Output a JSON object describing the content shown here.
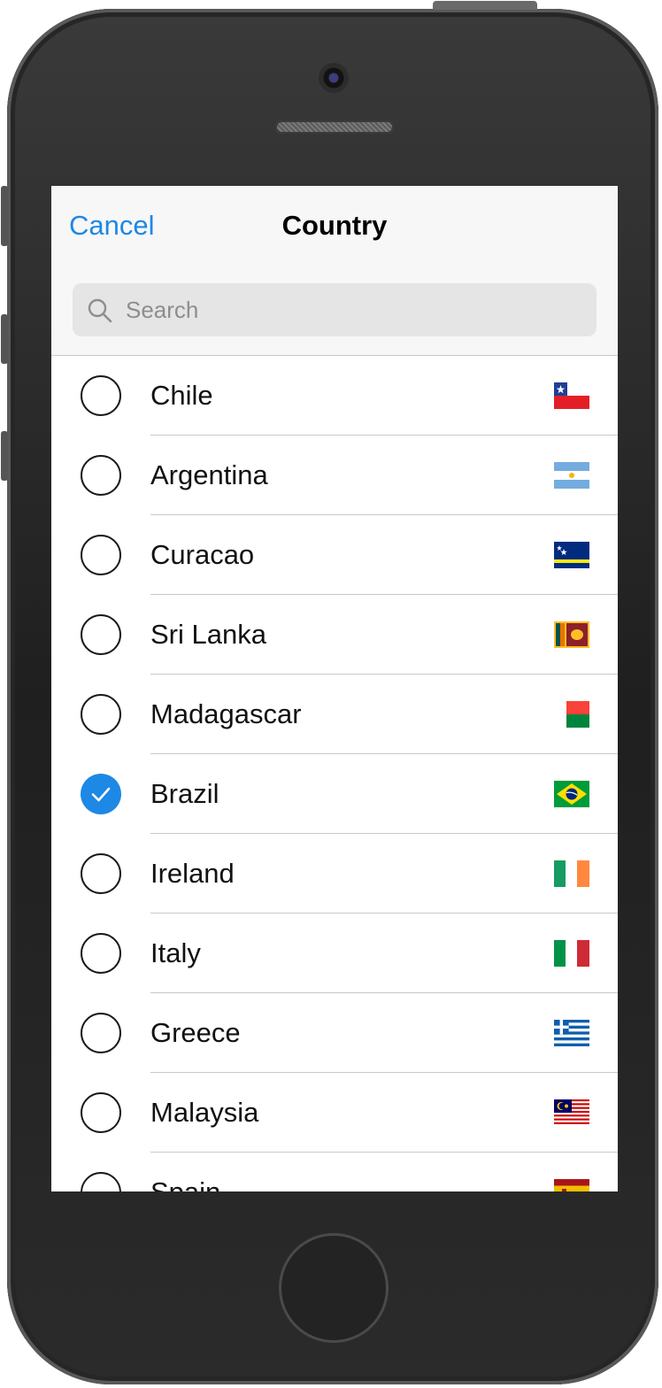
{
  "header": {
    "cancel_label": "Cancel",
    "title": "Country"
  },
  "search": {
    "placeholder": "Search"
  },
  "countries": [
    {
      "name": "Chile",
      "selected": false,
      "flag_icon": "chile-flag-icon"
    },
    {
      "name": "Argentina",
      "selected": false,
      "flag_icon": "argentina-flag-icon"
    },
    {
      "name": "Curacao",
      "selected": false,
      "flag_icon": "curacao-flag-icon"
    },
    {
      "name": "Sri Lanka",
      "selected": false,
      "flag_icon": "sri-lanka-flag-icon"
    },
    {
      "name": "Madagascar",
      "selected": false,
      "flag_icon": "madagascar-flag-icon"
    },
    {
      "name": "Brazil",
      "selected": true,
      "flag_icon": "brazil-flag-icon"
    },
    {
      "name": "Ireland",
      "selected": false,
      "flag_icon": "ireland-flag-icon"
    },
    {
      "name": "Italy",
      "selected": false,
      "flag_icon": "italy-flag-icon"
    },
    {
      "name": "Greece",
      "selected": false,
      "flag_icon": "greece-flag-icon"
    },
    {
      "name": "Malaysia",
      "selected": false,
      "flag_icon": "malaysia-flag-icon"
    },
    {
      "name": "Spain",
      "selected": false,
      "flag_icon": "spain-flag-icon"
    }
  ],
  "colors": {
    "accent": "#1e88e5",
    "nav_background": "#f7f7f7",
    "search_background": "#e5e5e5",
    "separator": "#c8c8c8"
  }
}
